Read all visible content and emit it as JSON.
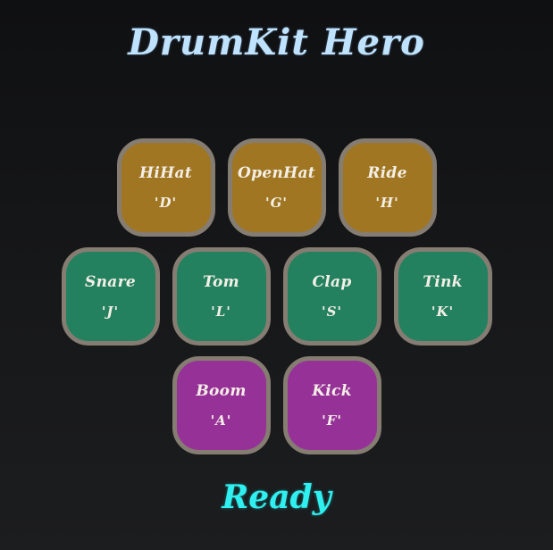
{
  "app": {
    "title": "DrumKit Hero",
    "status": "Ready"
  },
  "colors": {
    "cymbal": "#a07622",
    "drum": "#238160",
    "bass": "#963198",
    "border": "#857c72",
    "title": "#bfe3ff",
    "status": "#2ff0f0"
  },
  "pads": {
    "row1": [
      {
        "label": "HiHat",
        "key": "'D'",
        "color": "#a07622"
      },
      {
        "label": "OpenHat",
        "key": "'G'",
        "color": "#a07622"
      },
      {
        "label": "Ride",
        "key": "'H'",
        "color": "#a07622"
      }
    ],
    "row2": [
      {
        "label": "Snare",
        "key": "'J'",
        "color": "#238160"
      },
      {
        "label": "Tom",
        "key": "'L'",
        "color": "#238160"
      },
      {
        "label": "Clap",
        "key": "'S'",
        "color": "#238160"
      },
      {
        "label": "Tink",
        "key": "'K'",
        "color": "#238160"
      }
    ],
    "row3": [
      {
        "label": "Boom",
        "key": "'A'",
        "color": "#963198"
      },
      {
        "label": "Kick",
        "key": "'F'",
        "color": "#963198"
      }
    ]
  }
}
